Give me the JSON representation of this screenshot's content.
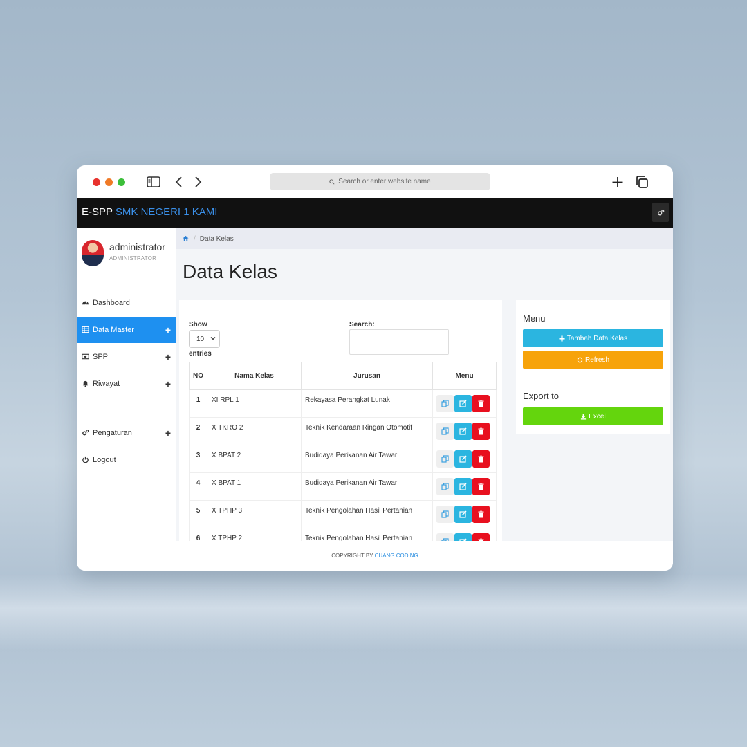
{
  "browser": {
    "url_placeholder": "Search or enter website name"
  },
  "navbar": {
    "brand": "E-SPP",
    "school": "SMK NEGERI 1 KAMI"
  },
  "profile": {
    "name": "administrator",
    "role": "ADMINISTRATOR"
  },
  "sidebar": {
    "items": [
      {
        "label": "Dashboard",
        "icon": "dashboard-icon"
      },
      {
        "label": "Data Master",
        "icon": "table-icon",
        "expandable": true,
        "active": true
      },
      {
        "label": "SPP",
        "icon": "money-icon",
        "expandable": true
      },
      {
        "label": "Riwayat",
        "icon": "bell-icon",
        "expandable": true
      },
      {
        "label": "Pengaturan",
        "icon": "gears-icon",
        "expandable": true
      },
      {
        "label": "Logout",
        "icon": "power-icon"
      }
    ],
    "plus": "+"
  },
  "breadcrumb": {
    "current": "Data Kelas"
  },
  "page": {
    "title": "Data Kelas"
  },
  "table_controls": {
    "show_label": "Show",
    "entries_value": "10",
    "entries_label": "entries",
    "search_label": "Search:"
  },
  "table": {
    "headers": [
      "NO",
      "Nama Kelas",
      "Jurusan",
      "Menu"
    ],
    "rows": [
      {
        "no": "1",
        "kelas": "XI RPL 1",
        "jurusan": "Rekayasa Perangkat Lunak"
      },
      {
        "no": "2",
        "kelas": "X TKRO 2",
        "jurusan": "Teknik Kendaraan Ringan Otomotif"
      },
      {
        "no": "3",
        "kelas": "X BPAT 2",
        "jurusan": "Budidaya Perikanan Air Tawar"
      },
      {
        "no": "4",
        "kelas": "X BPAT 1",
        "jurusan": "Budidaya Perikanan Air Tawar"
      },
      {
        "no": "5",
        "kelas": "X TPHP 3",
        "jurusan": "Teknik Pengolahan Hasil Pertanian"
      },
      {
        "no": "6",
        "kelas": "X TPHP 2",
        "jurusan": "Teknik Pengolahan Hasil Pertanian"
      }
    ]
  },
  "right_panel": {
    "menu_title": "Menu",
    "add_label": "Tambah Data Kelas",
    "refresh_label": "Refresh",
    "export_title": "Export to",
    "excel_label": "Excel"
  },
  "colors": {
    "accent_blue": "#1e90f0",
    "add_button": "#2bb5e0",
    "refresh_button": "#f7a30a",
    "excel_button": "#64d50d",
    "delete_button": "#e8101f",
    "navbar": "#111111"
  },
  "footer": {
    "prefix": "COPYRIGHT BY",
    "brand": "CUANG CODING"
  }
}
